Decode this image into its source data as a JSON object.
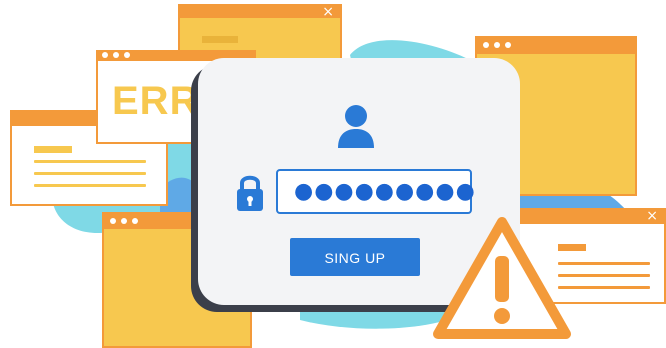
{
  "error_card": {
    "label": "ERROR"
  },
  "login": {
    "password_mask": "●●●●●●●●●",
    "submit_label": "SING UP"
  },
  "icons": [
    "user-icon",
    "lock-icon",
    "warning-icon",
    "close-icon"
  ],
  "colors": {
    "accent_blue": "#2a7ad6",
    "window_yellow": "#f7c84f",
    "window_orange": "#f39a3a",
    "blob_teal": "#7fd9e6",
    "blob_blue": "#5fa9e6",
    "dialog_bg": "#f3f4f6",
    "shadow_dark": "#3b3f4a"
  }
}
